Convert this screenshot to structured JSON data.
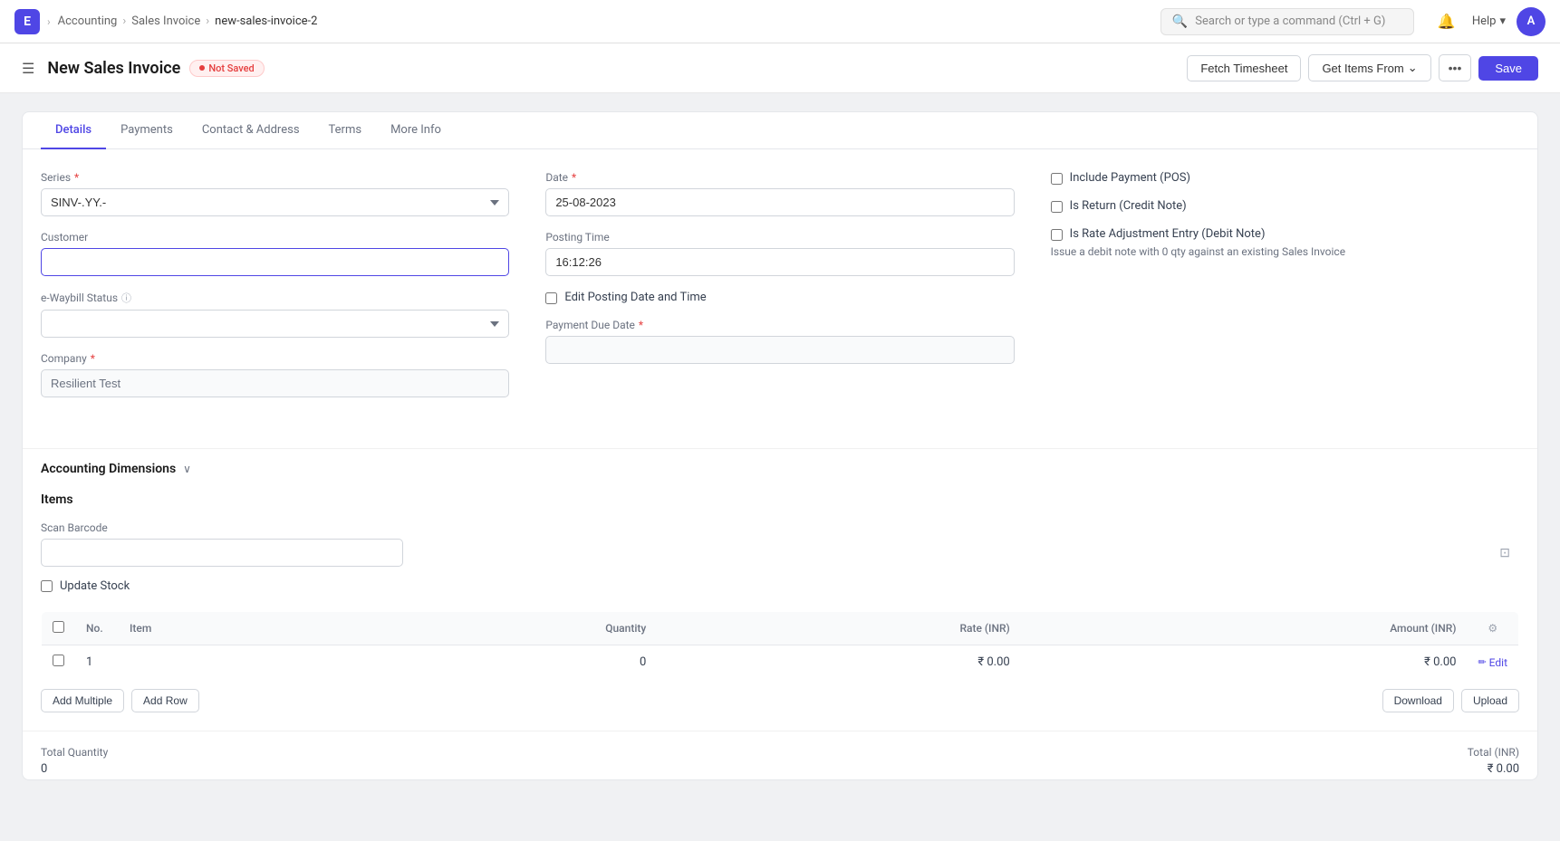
{
  "app": {
    "icon": "E",
    "icon_color": "#4f46e5"
  },
  "breadcrumb": {
    "items": [
      "Accounting",
      "Sales Invoice",
      "new-sales-invoice-2"
    ]
  },
  "topnav": {
    "search_placeholder": "Search or type a command (Ctrl + G)",
    "help_label": "Help",
    "avatar_label": "A"
  },
  "page": {
    "title": "New Sales Invoice",
    "status": "Not Saved",
    "hamburger_icon": "☰"
  },
  "actions": {
    "fetch_timesheet": "Fetch Timesheet",
    "get_items_from": "Get Items From",
    "more_icon": "•••",
    "save": "Save"
  },
  "tabs": [
    {
      "id": "details",
      "label": "Details",
      "active": true
    },
    {
      "id": "payments",
      "label": "Payments",
      "active": false
    },
    {
      "id": "contact-address",
      "label": "Contact & Address",
      "active": false
    },
    {
      "id": "terms",
      "label": "Terms",
      "active": false
    },
    {
      "id": "more-info",
      "label": "More Info",
      "active": false
    }
  ],
  "form": {
    "series": {
      "label": "Series",
      "required": true,
      "value": "SINV-.YY.-"
    },
    "customer": {
      "label": "Customer",
      "required": false,
      "value": "",
      "placeholder": ""
    },
    "ewaybill_status": {
      "label": "e-Waybill Status",
      "help": true,
      "value": ""
    },
    "company": {
      "label": "Company",
      "required": true,
      "value": "Resilient Test"
    },
    "date": {
      "label": "Date",
      "required": true,
      "value": "25-08-2023"
    },
    "posting_time": {
      "label": "Posting Time",
      "value": "16:12:26"
    },
    "edit_posting": {
      "label": "Edit Posting Date and Time"
    },
    "payment_due_date": {
      "label": "Payment Due Date",
      "required": true,
      "value": ""
    },
    "include_payment": {
      "label": "Include Payment (POS)"
    },
    "is_return": {
      "label": "Is Return (Credit Note)"
    },
    "rate_adjustment": {
      "label": "Is Rate Adjustment Entry (Debit Note)",
      "description": "Issue a debit note with 0 qty against an existing Sales Invoice"
    }
  },
  "accounting_dimensions": {
    "title": "Accounting Dimensions",
    "collapsed": false,
    "chevron": "∨"
  },
  "items_section": {
    "title": "Items",
    "scan_barcode_label": "Scan Barcode",
    "scan_placeholder": "",
    "update_stock_label": "Update Stock"
  },
  "items_table": {
    "columns": [
      "",
      "No.",
      "Item",
      "Quantity",
      "Rate (INR)",
      "Amount (INR)",
      ""
    ],
    "rows": [
      {
        "checked": false,
        "no": "1",
        "item": "",
        "quantity": "0",
        "rate": "₹ 0.00",
        "amount": "₹ 0.00",
        "edit_label": "Edit"
      }
    ]
  },
  "table_actions": {
    "add_multiple": "Add Multiple",
    "add_row": "Add Row",
    "download": "Download",
    "upload": "Upload"
  },
  "totals": {
    "total_quantity_label": "Total Quantity",
    "total_quantity_value": "0",
    "total_inr_label": "Total (INR)",
    "total_inr_value": "₹ 0.00"
  }
}
